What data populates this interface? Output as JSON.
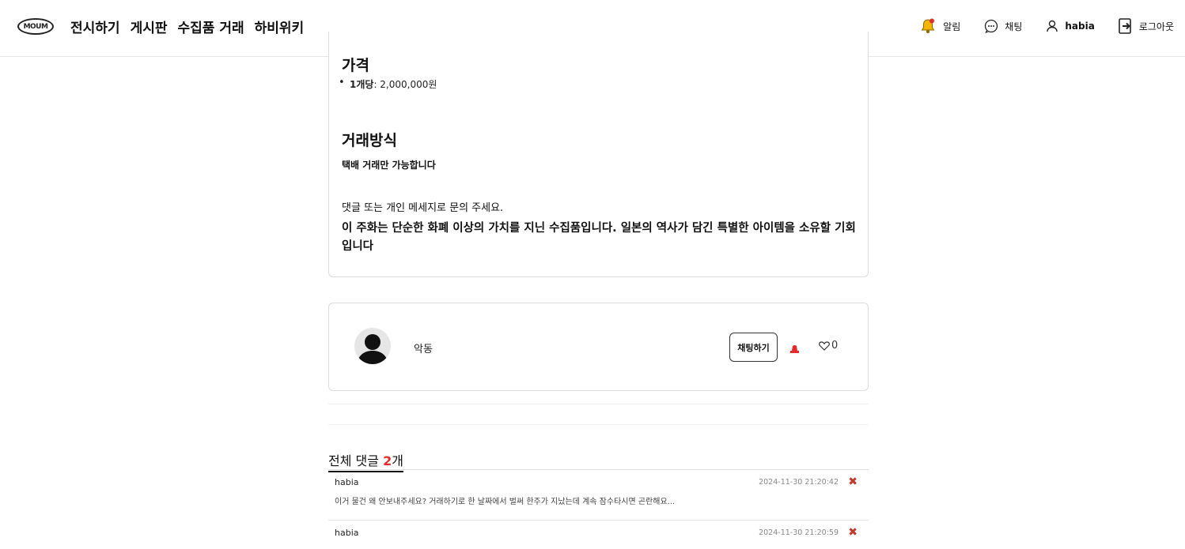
{
  "nav": {
    "logo": "MOUM",
    "links": [
      "전시하기",
      "게시판",
      "수집품 거래",
      "하비위키"
    ],
    "alarm_label": "알림",
    "chat_label": "채팅",
    "user_label": "habia",
    "logout_label": "로그아웃",
    "accent_color": "#f5b400"
  },
  "description": {
    "price_heading": "가격",
    "price_item_label": "1개당",
    "price_item_value": ": 2,000,000원",
    "trade_heading": "거래방식",
    "trade_text": "택배 거래만 가능합니다",
    "contact_text": "댓글 또는 개인 메세지로 문의 주세요.",
    "highlight_text": "이 주화는 단순한 화폐 이상의 가치를 지닌 수집품입니다. 일본의 역사가 담긴 특별한 아이템을 소유할 기회입니다"
  },
  "seller": {
    "name": "악동",
    "chat_button": "채팅하기",
    "like_count": "0"
  },
  "comments": {
    "title_prefix": "전체 댓글 ",
    "count": "2",
    "title_suffix": "개",
    "items": [
      {
        "author": "habia",
        "date": "2024-11-30 21:20:42",
        "body": "이거 물건 왜 안보내주세요? 거래하기로 한 날짜에서 벌써 한주가 지났는데 계속 잠수타시면 곤란해요..."
      },
      {
        "author": "habia",
        "date": "2024-11-30 21:20:59",
        "body": ""
      }
    ]
  }
}
